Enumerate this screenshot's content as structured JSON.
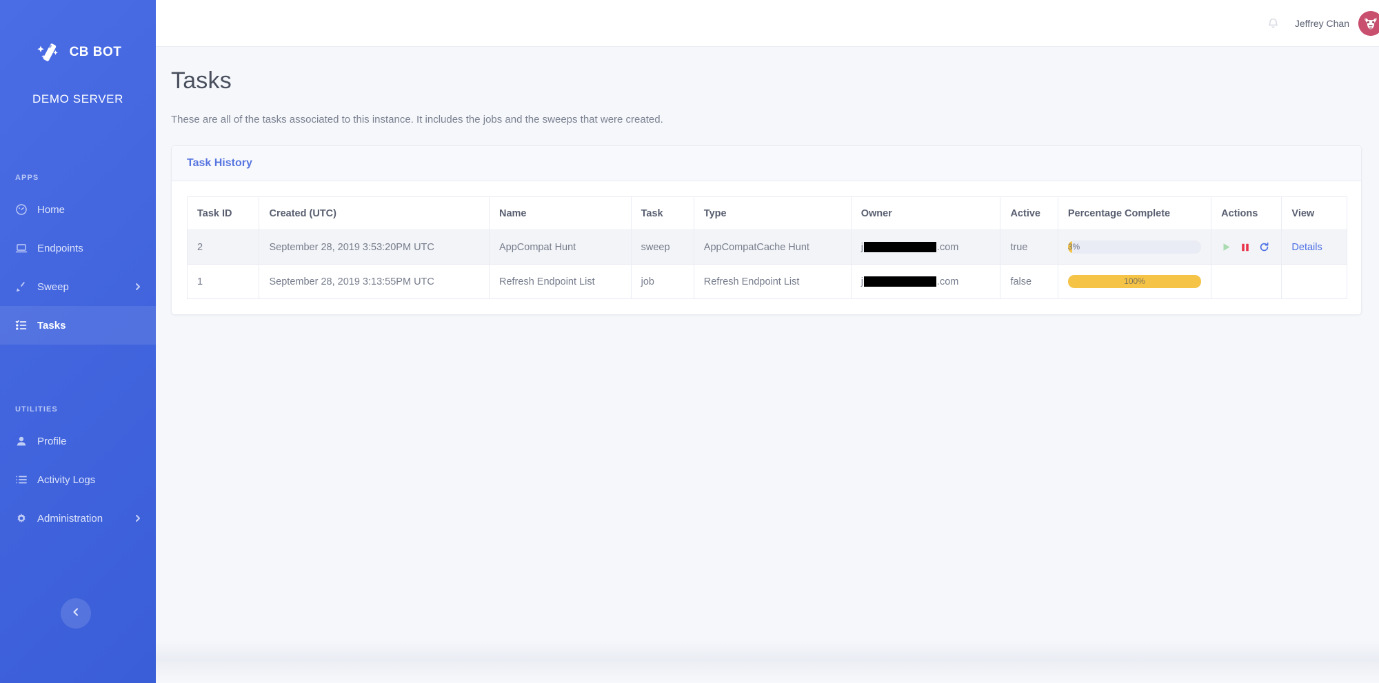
{
  "sidebar": {
    "brand": {
      "name": "CB BOT",
      "icon": "magic-wand-icon"
    },
    "server_name": "DEMO SERVER",
    "sections": [
      {
        "label": "APPS",
        "items": [
          {
            "label": "Home",
            "icon": "dashboard-icon",
            "active": false,
            "caret": false
          },
          {
            "label": "Endpoints",
            "icon": "laptop-icon",
            "active": false,
            "caret": false
          },
          {
            "label": "Sweep",
            "icon": "broom-icon",
            "active": false,
            "caret": true
          },
          {
            "label": "Tasks",
            "icon": "task-list-icon",
            "active": true,
            "caret": false
          }
        ]
      },
      {
        "label": "UTILITIES",
        "items": [
          {
            "label": "Profile",
            "icon": "user-icon",
            "active": false,
            "caret": false
          },
          {
            "label": "Activity Logs",
            "icon": "list-icon",
            "active": false,
            "caret": false
          },
          {
            "label": "Administration",
            "icon": "gear-icon",
            "active": false,
            "caret": true
          }
        ]
      }
    ],
    "collapse_icon": "chevron-left-icon"
  },
  "navbar": {
    "notification_icon": "bell-icon",
    "user_name": "Jeffrey Chan",
    "avatar_icon": "user-avatar"
  },
  "page": {
    "title": "Tasks",
    "description": "These are all of the tasks associated to this instance. It includes the jobs and the sweeps that were created."
  },
  "card": {
    "title": "Task History"
  },
  "table": {
    "columns": [
      "Task ID",
      "Created (UTC)",
      "Name",
      "Task",
      "Type",
      "Owner",
      "Active",
      "Percentage Complete",
      "Actions",
      "View"
    ],
    "rows": [
      {
        "task_id": "2",
        "created": "September 28, 2019 3:53:20PM UTC",
        "name": "AppCompat Hunt",
        "task": "sweep",
        "type": "AppCompatCache Hunt",
        "owner_prefix": "j",
        "owner_suffix": ".com",
        "owner_redacted": true,
        "active": "true",
        "percent": 3,
        "percent_label": "3%",
        "actions": [
          "play-icon",
          "pause-icon",
          "refresh-icon"
        ],
        "view_label": "Details"
      },
      {
        "task_id": "1",
        "created": "September 28, 2019 3:13:55PM UTC",
        "name": "Refresh Endpoint List",
        "task": "job",
        "type": "Refresh Endpoint List",
        "owner_prefix": "j",
        "owner_suffix": ".com",
        "owner_redacted": true,
        "active": "false",
        "percent": 100,
        "percent_label": "100%",
        "actions": [],
        "view_label": ""
      }
    ]
  },
  "colors": {
    "sidebar_blue": "#3f63dd",
    "accent_link": "#4b6ee5",
    "card_title": "#5775e0",
    "progress_yellow": "#f5c345",
    "progress_track": "#e9ecf5",
    "play_green": "#a8dcb0",
    "pause_red": "#e8354a",
    "refresh_blue": "#4b6ee5",
    "avatar_bg": "#c84f6e"
  }
}
